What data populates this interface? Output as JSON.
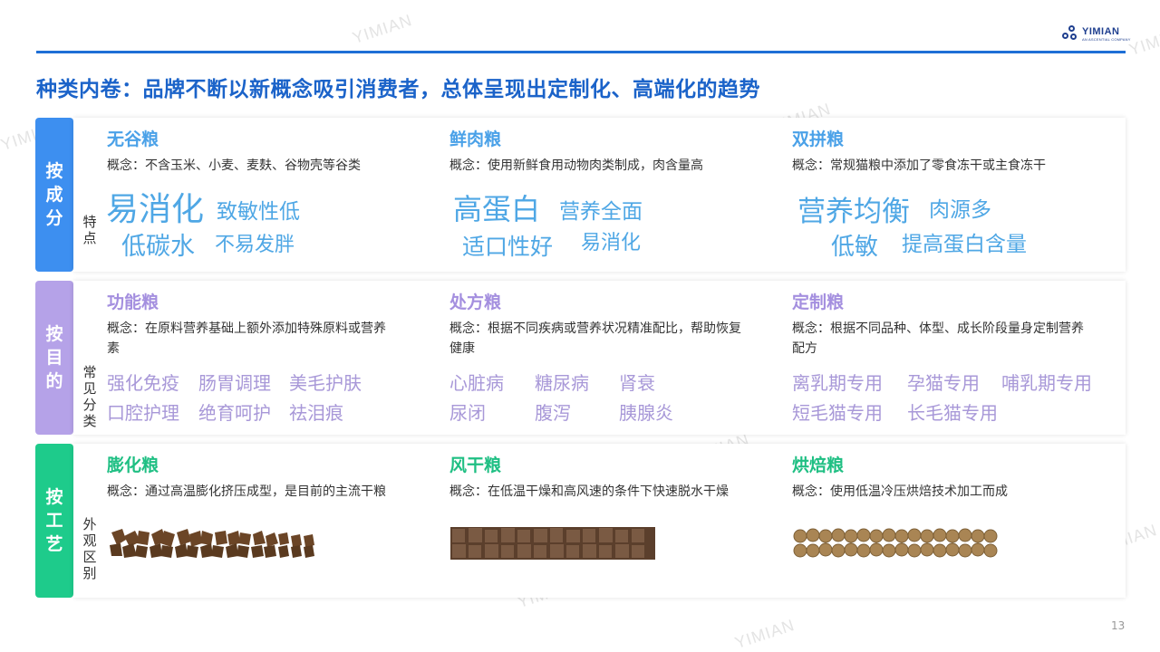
{
  "header": {
    "logo_name": "YIMIAN",
    "logo_sub": "AN ASCENTIAL COMPANY",
    "title": "种类内卷：品牌不断以新概念吸引消费者，总体呈现出定制化、高端化的趋势"
  },
  "watermark": "YIMIAN",
  "accent_colors": {
    "blue_tab": "#3d8ff0",
    "purple_tab": "#b5a2e8",
    "green_tab": "#1ecb8b",
    "title": "#1b63c9"
  },
  "rows": [
    {
      "tab": [
        "按",
        "成",
        "分"
      ],
      "side_label": [
        "特",
        "点"
      ],
      "title_color": "#4aa1e8",
      "columns": [
        {
          "title": "无谷粮",
          "concept": "概念：不含玉米、小麦、麦麸、谷物壳等谷类",
          "keywords": [
            "易消化",
            "致敏性低",
            "低碳水",
            "不易发胖"
          ]
        },
        {
          "title": "鲜肉粮",
          "concept": "概念：使用新鲜食用动物肉类制成，肉含量高",
          "keywords": [
            "高蛋白",
            "营养全面",
            "适口性好",
            "易消化"
          ]
        },
        {
          "title": "双拼粮",
          "concept": "概念：常规猫粮中添加了零食冻干或主食冻干",
          "keywords": [
            "营养均衡",
            "肉源多",
            "低敏",
            "提高蛋白含量"
          ]
        }
      ]
    },
    {
      "tab": [
        "按",
        "目",
        "的"
      ],
      "side_label": [
        "常",
        "见",
        "分",
        "类"
      ],
      "title_color": "#a48fdf",
      "columns": [
        {
          "title": "功能粮",
          "concept": "概念：在原料营养基础上额外添加特殊原料或营养素",
          "keywords": [
            "强化免疫",
            "肠胃调理",
            "美毛护肤",
            "口腔护理",
            "绝育呵护",
            "祛泪痕"
          ]
        },
        {
          "title": "处方粮",
          "concept": "概念：根据不同疾病或营养状况精准配比，帮助恢复健康",
          "keywords": [
            "心脏病",
            "糖尿病",
            "肾衰",
            "尿闭",
            "腹泻",
            "胰腺炎"
          ]
        },
        {
          "title": "定制粮",
          "concept": "概念：根据不同品种、体型、成长阶段量身定制营养配方",
          "keywords": [
            "离乳期专用",
            "孕猫专用",
            "哺乳期专用",
            "短毛猫专用",
            "长毛猫专用"
          ]
        }
      ]
    },
    {
      "tab": [
        "按",
        "工",
        "艺"
      ],
      "side_label": [
        "外",
        "观",
        "区",
        "别"
      ],
      "title_color": "#1fbf83",
      "columns": [
        {
          "title": "膨化粮",
          "concept": "概念：通过高温膨化挤压成型，是目前的主流干粮",
          "image": "extruded-kibble"
        },
        {
          "title": "风干粮",
          "concept": "概念：在低温干燥和高风速的条件下快速脱水干燥",
          "image": "air-dried-cubes"
        },
        {
          "title": "烘焙粮",
          "concept": "概念：使用低温冷压烘焙技术加工而成",
          "image": "baked-pellets"
        }
      ]
    }
  ],
  "page_number": "13"
}
